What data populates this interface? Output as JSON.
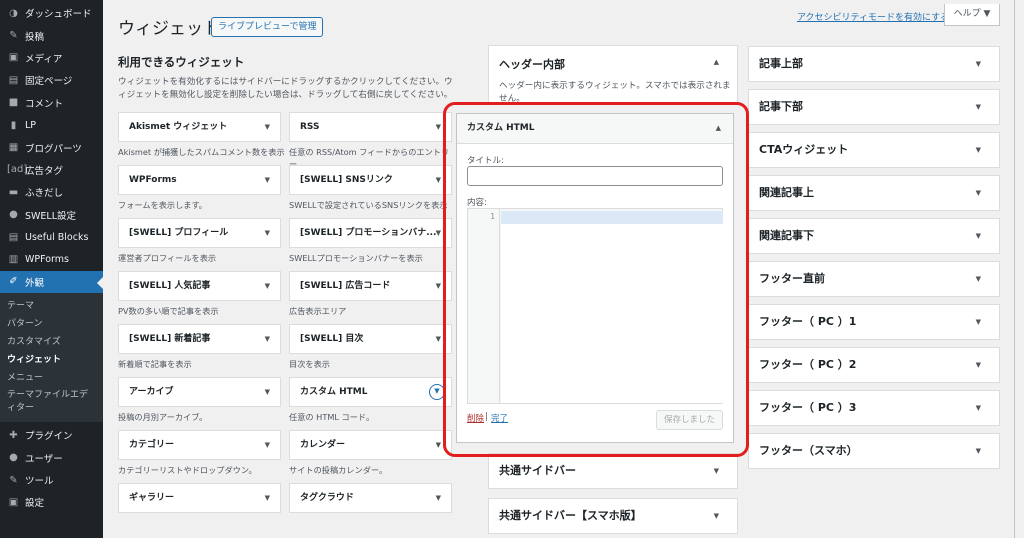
{
  "sidebar": {
    "items_top": [
      {
        "icon": "dashboard-icon",
        "glyph": "◑",
        "label": "ダッシュボード"
      },
      {
        "icon": "pin-icon",
        "glyph": "✎",
        "label": "投稿"
      },
      {
        "icon": "media-icon",
        "glyph": "▣",
        "label": "メディア"
      },
      {
        "icon": "page-icon",
        "glyph": "▤",
        "label": "固定ページ"
      },
      {
        "icon": "comment-icon",
        "glyph": "■",
        "label": "コメント"
      },
      {
        "icon": "lp-icon",
        "glyph": "▮",
        "label": "LP"
      },
      {
        "icon": "blog-parts-icon",
        "glyph": "▦",
        "label": "ブログパーツ"
      },
      {
        "icon": "ad-tag-icon",
        "glyph": "[ad]",
        "label": "広告タグ"
      },
      {
        "icon": "balloon-icon",
        "glyph": "▬",
        "label": "ふきだし"
      },
      {
        "icon": "swell-icon",
        "glyph": "●",
        "label": "SWELL設定"
      },
      {
        "icon": "blocks-icon",
        "glyph": "▤",
        "label": "Useful Blocks"
      },
      {
        "icon": "wpforms-icon",
        "glyph": "▥",
        "label": "WPForms"
      }
    ],
    "active": {
      "icon": "appearance-icon",
      "glyph": "✐",
      "label": "外観"
    },
    "sub_items": [
      "テーマ",
      "パターン",
      "カスタマイズ",
      "ウィジェット",
      "メニュー",
      "テーマファイルエディター"
    ],
    "current_sub": "ウィジェット",
    "items_bottom": [
      {
        "icon": "plugin-icon",
        "glyph": "✚",
        "label": "プラグイン"
      },
      {
        "icon": "user-icon",
        "glyph": "●",
        "label": "ユーザー"
      },
      {
        "icon": "tool-icon",
        "glyph": "✎",
        "label": "ツール"
      },
      {
        "icon": "settings-icon",
        "glyph": "▣",
        "label": "設定"
      }
    ]
  },
  "header": {
    "title": "ウィジェット",
    "live_preview": "ライブプレビューで管理",
    "a11y_link": "アクセシビリティモードを有効にする",
    "help": "ヘルプ ▼"
  },
  "available": {
    "title": "利用できるウィジェット",
    "desc": "ウィジェットを有効化するにはサイドバーにドラッグするかクリックしてください。ウィジェットを無効化し設定を削除したい場合は、ドラッグして右側に戻してください。",
    "widgets": [
      {
        "name": "Akismet ウィジェット",
        "desc": "Akismet が捕獲したスパムコメント数を表示"
      },
      {
        "name": "RSS",
        "desc": "任意の RSS/Atom フィードからのエントリー。"
      },
      {
        "name": "WPForms",
        "desc": "フォームを表示します。"
      },
      {
        "name": "[SWELL] SNSリンク",
        "desc": "SWELLで設定されているSNSリンクを表示"
      },
      {
        "name": "[SWELL] プロフィール",
        "desc": "運営者プロフィールを表示"
      },
      {
        "name": "[SWELL] プロモーションバナ...",
        "desc": "SWELLプロモーションバナーを表示"
      },
      {
        "name": "[SWELL] 人気記事",
        "desc": "PV数の多い順で記事を表示"
      },
      {
        "name": "[SWELL] 広告コード",
        "desc": "広告表示エリア"
      },
      {
        "name": "[SWELL] 新着記事",
        "desc": "新着順で記事を表示"
      },
      {
        "name": "[SWELL] 目次",
        "desc": "目次を表示"
      },
      {
        "name": "アーカイブ",
        "desc": "投稿の月別アーカイブ。"
      },
      {
        "name": "カスタム HTML",
        "desc": "任意の HTML コード。"
      },
      {
        "name": "カテゴリー",
        "desc": "カテゴリーリストやドロップダウン。"
      },
      {
        "name": "カレンダー",
        "desc": "サイトの投稿カレンダー。"
      },
      {
        "name": "ギャラリー",
        "desc": ""
      },
      {
        "name": "タグクラウド",
        "desc": ""
      }
    ]
  },
  "areas_mid": {
    "header_inner": {
      "title": "ヘッダー内部",
      "desc": "ヘッダー内に表示するウィジェット。スマホでは表示されません。"
    },
    "common_sidebar": "共通サイドバー",
    "common_sidebar_sp": "共通サイドバー【スマホ版】"
  },
  "areas_right": [
    "記事上部",
    "記事下部",
    "CTAウィジェット",
    "関連記事上",
    "関連記事下",
    "フッター直前",
    "フッター（ PC ）1",
    "フッター（ PC ）2",
    "フッター（ PC ）3",
    "フッター（スマホ）"
  ],
  "editor": {
    "title": "カスタム HTML",
    "title_label": "タイトル:",
    "title_value": "",
    "content_label": "内容:",
    "line_number": "1",
    "delete": "削除",
    "separator": "|",
    "done": "完了",
    "saved": "保存しました"
  },
  "colors": {
    "sidebar_bg": "#1d2327",
    "accent": "#2271b1",
    "highlight": "#e21d1d"
  }
}
